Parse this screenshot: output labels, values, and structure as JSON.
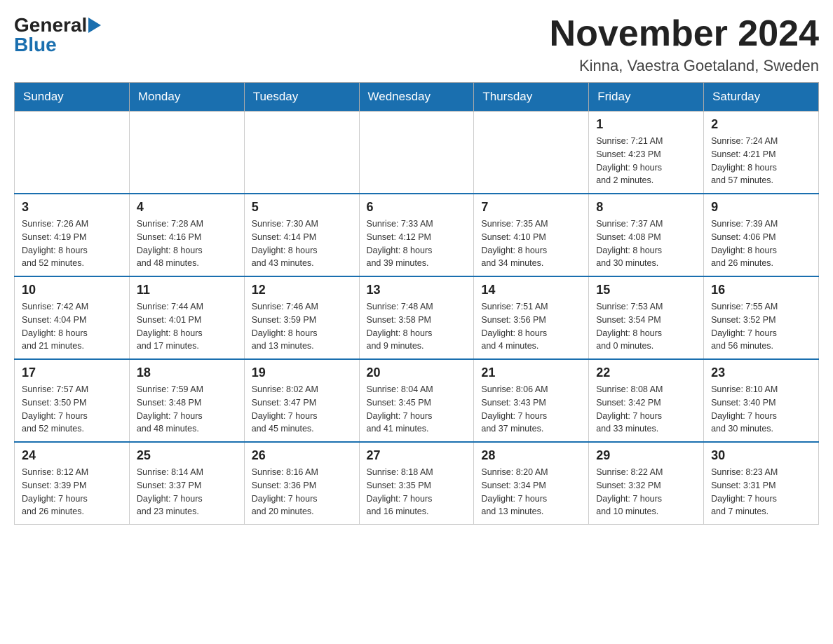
{
  "header": {
    "logo_general": "General",
    "logo_blue": "Blue",
    "month_title": "November 2024",
    "location": "Kinna, Vaestra Goetaland, Sweden"
  },
  "days_of_week": [
    "Sunday",
    "Monday",
    "Tuesday",
    "Wednesday",
    "Thursday",
    "Friday",
    "Saturday"
  ],
  "weeks": [
    [
      {
        "day": "",
        "info": ""
      },
      {
        "day": "",
        "info": ""
      },
      {
        "day": "",
        "info": ""
      },
      {
        "day": "",
        "info": ""
      },
      {
        "day": "",
        "info": ""
      },
      {
        "day": "1",
        "info": "Sunrise: 7:21 AM\nSunset: 4:23 PM\nDaylight: 9 hours\nand 2 minutes."
      },
      {
        "day": "2",
        "info": "Sunrise: 7:24 AM\nSunset: 4:21 PM\nDaylight: 8 hours\nand 57 minutes."
      }
    ],
    [
      {
        "day": "3",
        "info": "Sunrise: 7:26 AM\nSunset: 4:19 PM\nDaylight: 8 hours\nand 52 minutes."
      },
      {
        "day": "4",
        "info": "Sunrise: 7:28 AM\nSunset: 4:16 PM\nDaylight: 8 hours\nand 48 minutes."
      },
      {
        "day": "5",
        "info": "Sunrise: 7:30 AM\nSunset: 4:14 PM\nDaylight: 8 hours\nand 43 minutes."
      },
      {
        "day": "6",
        "info": "Sunrise: 7:33 AM\nSunset: 4:12 PM\nDaylight: 8 hours\nand 39 minutes."
      },
      {
        "day": "7",
        "info": "Sunrise: 7:35 AM\nSunset: 4:10 PM\nDaylight: 8 hours\nand 34 minutes."
      },
      {
        "day": "8",
        "info": "Sunrise: 7:37 AM\nSunset: 4:08 PM\nDaylight: 8 hours\nand 30 minutes."
      },
      {
        "day": "9",
        "info": "Sunrise: 7:39 AM\nSunset: 4:06 PM\nDaylight: 8 hours\nand 26 minutes."
      }
    ],
    [
      {
        "day": "10",
        "info": "Sunrise: 7:42 AM\nSunset: 4:04 PM\nDaylight: 8 hours\nand 21 minutes."
      },
      {
        "day": "11",
        "info": "Sunrise: 7:44 AM\nSunset: 4:01 PM\nDaylight: 8 hours\nand 17 minutes."
      },
      {
        "day": "12",
        "info": "Sunrise: 7:46 AM\nSunset: 3:59 PM\nDaylight: 8 hours\nand 13 minutes."
      },
      {
        "day": "13",
        "info": "Sunrise: 7:48 AM\nSunset: 3:58 PM\nDaylight: 8 hours\nand 9 minutes."
      },
      {
        "day": "14",
        "info": "Sunrise: 7:51 AM\nSunset: 3:56 PM\nDaylight: 8 hours\nand 4 minutes."
      },
      {
        "day": "15",
        "info": "Sunrise: 7:53 AM\nSunset: 3:54 PM\nDaylight: 8 hours\nand 0 minutes."
      },
      {
        "day": "16",
        "info": "Sunrise: 7:55 AM\nSunset: 3:52 PM\nDaylight: 7 hours\nand 56 minutes."
      }
    ],
    [
      {
        "day": "17",
        "info": "Sunrise: 7:57 AM\nSunset: 3:50 PM\nDaylight: 7 hours\nand 52 minutes."
      },
      {
        "day": "18",
        "info": "Sunrise: 7:59 AM\nSunset: 3:48 PM\nDaylight: 7 hours\nand 48 minutes."
      },
      {
        "day": "19",
        "info": "Sunrise: 8:02 AM\nSunset: 3:47 PM\nDaylight: 7 hours\nand 45 minutes."
      },
      {
        "day": "20",
        "info": "Sunrise: 8:04 AM\nSunset: 3:45 PM\nDaylight: 7 hours\nand 41 minutes."
      },
      {
        "day": "21",
        "info": "Sunrise: 8:06 AM\nSunset: 3:43 PM\nDaylight: 7 hours\nand 37 minutes."
      },
      {
        "day": "22",
        "info": "Sunrise: 8:08 AM\nSunset: 3:42 PM\nDaylight: 7 hours\nand 33 minutes."
      },
      {
        "day": "23",
        "info": "Sunrise: 8:10 AM\nSunset: 3:40 PM\nDaylight: 7 hours\nand 30 minutes."
      }
    ],
    [
      {
        "day": "24",
        "info": "Sunrise: 8:12 AM\nSunset: 3:39 PM\nDaylight: 7 hours\nand 26 minutes."
      },
      {
        "day": "25",
        "info": "Sunrise: 8:14 AM\nSunset: 3:37 PM\nDaylight: 7 hours\nand 23 minutes."
      },
      {
        "day": "26",
        "info": "Sunrise: 8:16 AM\nSunset: 3:36 PM\nDaylight: 7 hours\nand 20 minutes."
      },
      {
        "day": "27",
        "info": "Sunrise: 8:18 AM\nSunset: 3:35 PM\nDaylight: 7 hours\nand 16 minutes."
      },
      {
        "day": "28",
        "info": "Sunrise: 8:20 AM\nSunset: 3:34 PM\nDaylight: 7 hours\nand 13 minutes."
      },
      {
        "day": "29",
        "info": "Sunrise: 8:22 AM\nSunset: 3:32 PM\nDaylight: 7 hours\nand 10 minutes."
      },
      {
        "day": "30",
        "info": "Sunrise: 8:23 AM\nSunset: 3:31 PM\nDaylight: 7 hours\nand 7 minutes."
      }
    ]
  ]
}
